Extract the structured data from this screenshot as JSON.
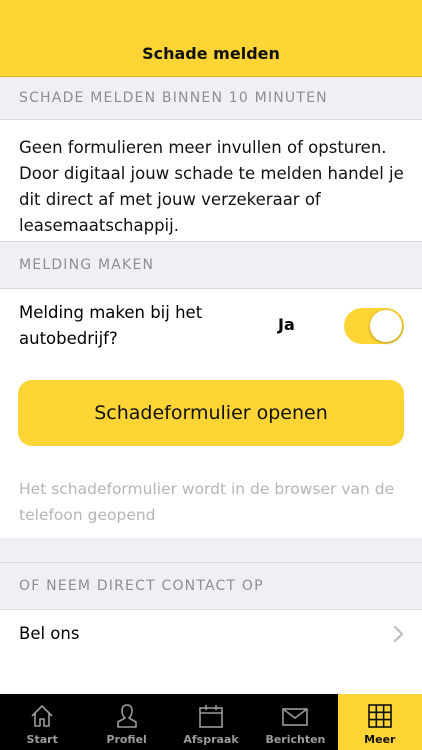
{
  "nav": {
    "title": "Schade melden"
  },
  "sections": {
    "report": "SCHADE MELDEN BINNEN 10 MINUTEN",
    "notify": "MELDING MAKEN",
    "contact": "OF NEEM DIRECT CONTACT OP"
  },
  "intro": "Geen formulieren meer invullen of opsturen. Door digitaal jouw schade te melden handel je dit direct af met jouw verzekeraar of leasemaatschappij.",
  "notify_toggle": {
    "label": "Melding maken bij het autobedrijf?",
    "value": "Ja",
    "on": true
  },
  "open_form_button": "Schadeformulier openen",
  "hint": "Het schadeformulier wordt in de browser van de telefoon geopend",
  "call": {
    "label": "Bel ons"
  },
  "tabs": [
    {
      "label": "Start",
      "icon": "home-icon"
    },
    {
      "label": "Profiel",
      "icon": "profile-icon"
    },
    {
      "label": "Afspraak",
      "icon": "calendar-icon"
    },
    {
      "label": "Berichten",
      "icon": "mail-icon"
    },
    {
      "label": "Meer",
      "icon": "grid-icon",
      "active": true
    }
  ],
  "colors": {
    "accent": "#fed535",
    "tabbar": "#000000",
    "background": "#efeff4"
  }
}
